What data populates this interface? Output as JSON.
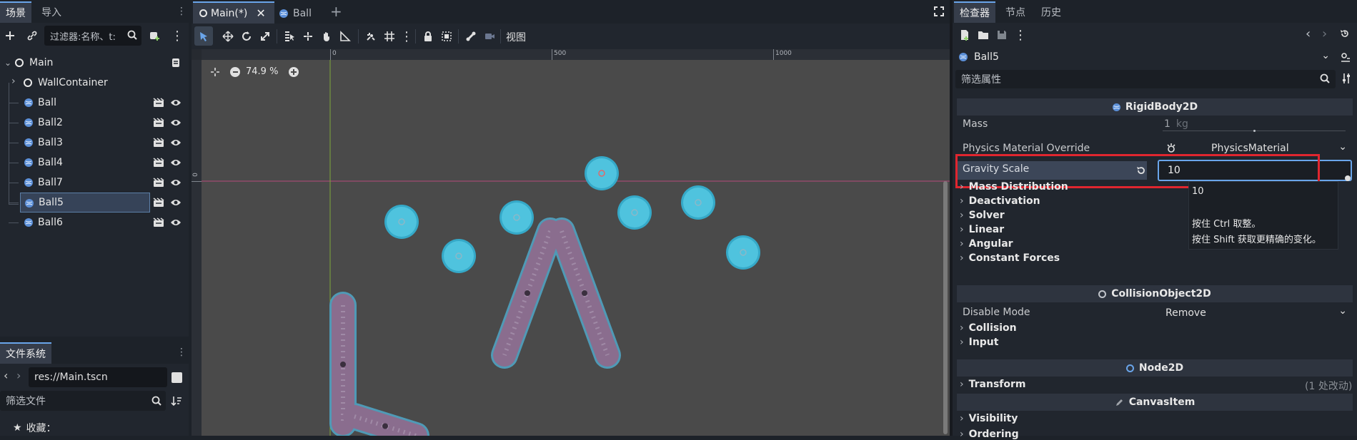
{
  "scene_dock": {
    "tabs": [
      "场景",
      "导入"
    ],
    "filter_placeholder": "过滤器:名称、t:",
    "nodes": [
      {
        "label": "Main",
        "type": "root"
      },
      {
        "label": "WallContainer",
        "type": "node2d"
      },
      {
        "label": "Ball",
        "type": "rigid"
      },
      {
        "label": "Ball2",
        "type": "rigid"
      },
      {
        "label": "Ball3",
        "type": "rigid"
      },
      {
        "label": "Ball4",
        "type": "rigid"
      },
      {
        "label": "Ball7",
        "type": "rigid"
      },
      {
        "label": "Ball5",
        "type": "rigid",
        "selected": true
      },
      {
        "label": "Ball6",
        "type": "rigid"
      }
    ]
  },
  "filesystem": {
    "tab": "文件系统",
    "path": "res://Main.tscn",
    "filter_placeholder": "筛选文件",
    "favorites": "收藏："
  },
  "editor": {
    "tabs": [
      {
        "label": "Main(*)",
        "active": true
      },
      {
        "label": "Ball",
        "active": false
      }
    ],
    "view_menu": "视图",
    "zoom": "74.9 %",
    "ruler_ticks": [
      "0",
      "500",
      "1000"
    ],
    "ruler_left": "0"
  },
  "inspector": {
    "tabs": [
      "检查器",
      "节点",
      "历史"
    ],
    "object_name": "Ball5",
    "filter_placeholder": "筛选属性",
    "sections": {
      "rigid": "RigidBody2D",
      "collision": "CollisionObject2D",
      "node2d": "Node2D",
      "canvas": "CanvasItem"
    },
    "mass_label": "Mass",
    "mass_value": "1",
    "mass_unit": "kg",
    "pmo_label": "Physics Material Override",
    "pmo_value": "PhysicsMaterial",
    "gravity_label": "Gravity Scale",
    "gravity_value": "10",
    "groups_rigid": [
      "Mass Distribution",
      "Deactivation",
      "Solver",
      "Linear",
      "Angular",
      "Constant Forces"
    ],
    "disable_mode_label": "Disable Mode",
    "disable_mode_value": "Remove",
    "groups_collision": [
      "Collision",
      "Input"
    ],
    "transform_label": "Transform",
    "transform_note": "(1 处改动)",
    "groups_canvas": [
      "Visibility",
      "Ordering"
    ],
    "tooltip": {
      "value": "10",
      "line1": "按住 Ctrl 取整。",
      "line2": "按住 Shift 获取更精确的变化。"
    }
  },
  "colors": {
    "accent": "#6aa5ea",
    "highlight_box": "#e0262f",
    "ball_fill": "#4fc3de",
    "wall_fill": "#8a6d8e",
    "viewport_bg": "#4a4a4a"
  }
}
